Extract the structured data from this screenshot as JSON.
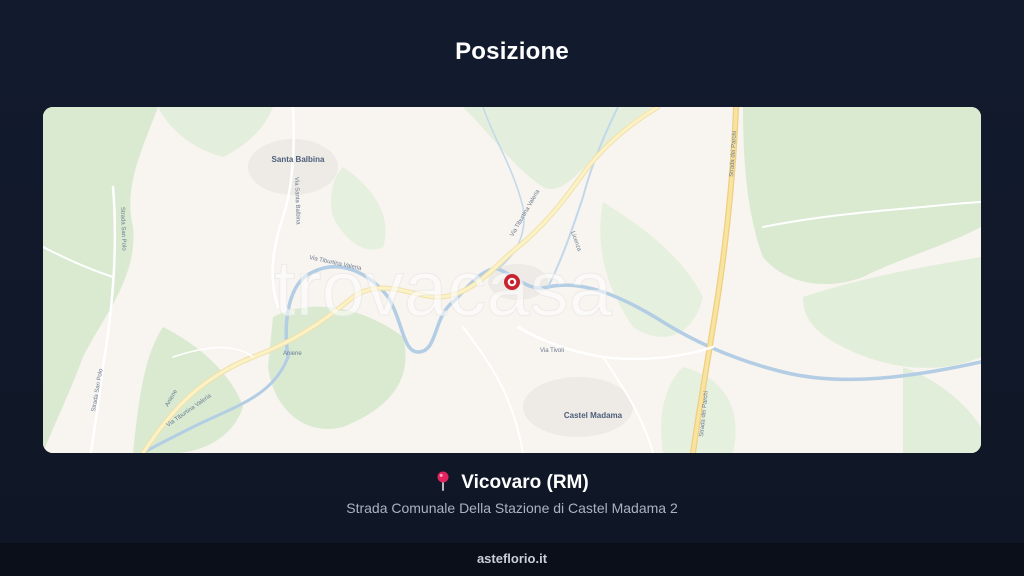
{
  "page": {
    "title": "Posizione"
  },
  "map": {
    "watermark": "trovacasa",
    "places": [
      {
        "name": "Santa Balbina"
      },
      {
        "name": "Castel Madama"
      }
    ],
    "road_labels": [
      "Via Tiburtina Valeria",
      "Via Tiburtina Valeria",
      "Via Tiburtina Valeria",
      "Strada dei Parchi",
      "Strada dei Parchi",
      "Via Santa Balbina",
      "Strada San Polo",
      "Strada San Polo",
      "Via Tivoli",
      "Aniene",
      "Aniene",
      "Licenza"
    ],
    "marker": {
      "name": "location-marker",
      "color": "#c8242f"
    }
  },
  "location": {
    "icon": "map-pin-icon",
    "name": "Vicovaro (RM)",
    "address": "Strada Comunale Della Stazione di Castel Madama 2"
  },
  "footer": {
    "site": "asteflorio.it"
  }
}
